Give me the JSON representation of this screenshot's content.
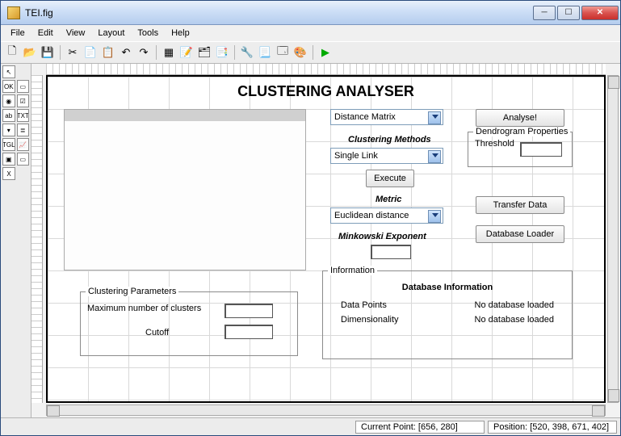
{
  "window": {
    "title": "TEI.fig"
  },
  "menu": {
    "file": "File",
    "edit": "Edit",
    "view": "View",
    "layout": "Layout",
    "tools": "Tools",
    "help": "Help"
  },
  "toolbar": {
    "new": "🗋",
    "open": "📂",
    "save": "💾",
    "cut": "✂",
    "copy": "📄",
    "paste": "📋",
    "undo": "↶",
    "redo": "↷",
    "align": "▦",
    "editor": "📝",
    "menu_editor": "🗂",
    "tab_editor": "📑",
    "toolbar_editor": "🔧",
    "property": "📃",
    "browser": "🗔",
    "palette": "🎨",
    "run": "▶"
  },
  "palette": {
    "pointer": "↖",
    "ok": "OK",
    "slider": "▭",
    "radio": "◉",
    "check": "☑",
    "edit": "ab",
    "text": "TXT",
    "popup": "▾",
    "list": "≣",
    "toggle": "TGL",
    "axes": "📈",
    "panel": "▣",
    "group": "▭",
    "activex": "X"
  },
  "gui": {
    "title": "CLUSTERING ANALYSER",
    "distance_select": "Distance Matrix",
    "clustering_methods_label": "Clustering Methods",
    "method_select": "Single Link",
    "execute": "Execute",
    "metric_label": "Metric",
    "metric_select": "Euclidean distance",
    "minkowski_label": "Minkowski Exponent",
    "analyse": "Analyse!",
    "dendro_legend": "Dendrogram Properties",
    "threshold_label": "Threshold",
    "transfer": "Transfer Data",
    "dbloader": "Database Loader",
    "clust_params_legend": "Clustering Parameters",
    "max_clusters_label": "Maximum number of clusters",
    "cutoff_label": "Cutoff",
    "info_legend": "Information",
    "db_info_header": "Database Information",
    "datapoints_label": "Data Points",
    "datapoints_value": "No database loaded",
    "dim_label": "Dimensionality",
    "dim_value": "No database loaded"
  },
  "status": {
    "current_point": "Current Point:   [656, 280]",
    "position": "Position: [520, 398, 671, 402]"
  }
}
